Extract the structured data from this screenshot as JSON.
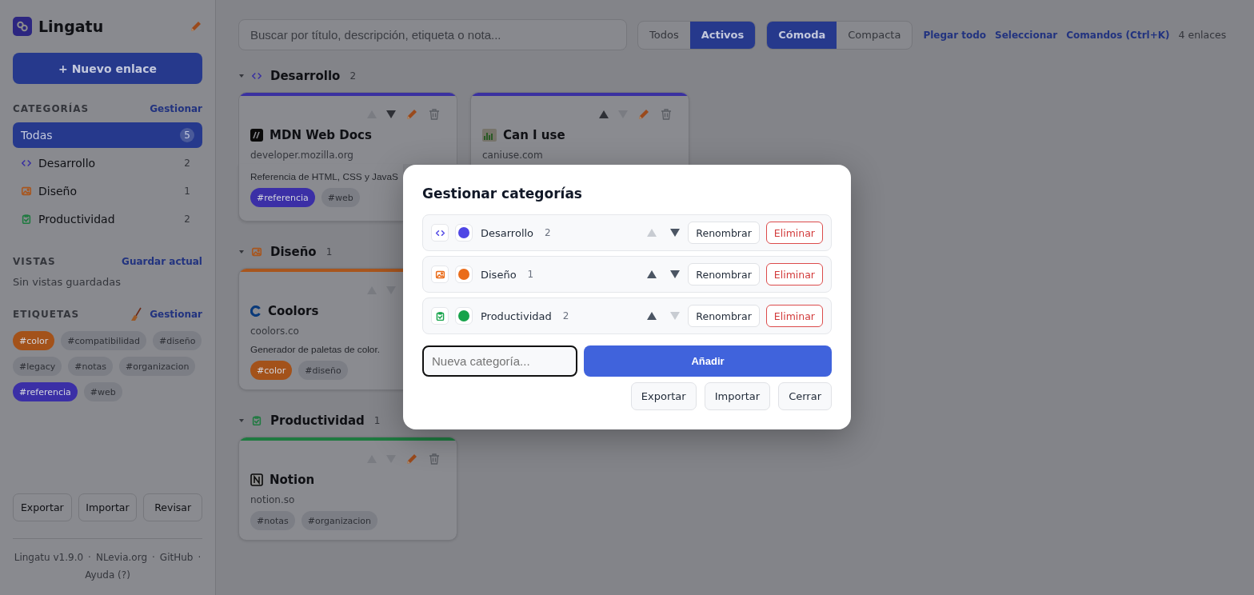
{
  "sidebar": {
    "app_name": "Lingatu",
    "new_button": "+ Nuevo enlace",
    "categories_heading": "CATEGORÍAS",
    "categories_action": "Gestionar",
    "categories": [
      {
        "name": "Todas",
        "count": "5",
        "selected": true
      },
      {
        "name": "Desarrollo",
        "count": "2",
        "selected": false,
        "color": "#3a31a0"
      },
      {
        "name": "Diseño",
        "count": "1",
        "selected": false,
        "color": "#a8561e"
      },
      {
        "name": "Productividad",
        "count": "2",
        "selected": false,
        "color": "#1f7a40"
      }
    ],
    "views_heading": "VISTAS",
    "views_action": "Guardar actual",
    "views_empty": "Sin vistas guardadas",
    "tags_heading": "ETIQUETAS",
    "tags_action": "Gestionar",
    "tags": [
      {
        "label": "#color",
        "color": "#a3521a"
      },
      {
        "label": "#compatibilidad",
        "color": "#7c7e85"
      },
      {
        "label": "#diseño",
        "color": "#7c7e85"
      },
      {
        "label": "#legacy",
        "color": "#7c7e85"
      },
      {
        "label": "#notas",
        "color": "#7c7e85"
      },
      {
        "label": "#organizacion",
        "color": "#7c7e85"
      },
      {
        "label": "#referencia",
        "color": "#3b2fa6"
      },
      {
        "label": "#web",
        "color": "#7c7e85"
      }
    ],
    "buttons": [
      "Exportar",
      "Importar",
      "Revisar"
    ],
    "footer": [
      "Lingatu v1.9.0",
      "·",
      "NLevia.org",
      "·",
      "GitHub",
      "·",
      "Ayuda (?)"
    ]
  },
  "toolbar": {
    "search": {
      "placeholder": "Buscar por título, descripción, etiqueta o nota..."
    },
    "filter": [
      {
        "label": "Todos",
        "selected": false
      },
      {
        "label": "Activos",
        "selected": true
      }
    ],
    "density": [
      {
        "label": "Cómoda",
        "selected": true
      },
      {
        "label": "Compacta",
        "selected": false
      }
    ],
    "links": [
      "Plegar todo",
      "Seleccionar",
      "Comandos (Ctrl+K)"
    ],
    "count": "4 enlaces"
  },
  "sections": [
    {
      "name": "Desarrollo",
      "count": "2",
      "color": "#3a31a0",
      "expanded": true,
      "cards": [
        {
          "title": "MDN Web Docs",
          "domain": "developer.mozilla.org",
          "description": "Referencia de HTML, CSS y JavaS",
          "can_move_up": false,
          "can_move_down": true,
          "actions": true,
          "tags": [
            {
              "label": "#referencia",
              "color": "#3b2fa6"
            },
            {
              "label": "#web",
              "color": "#7c7e85"
            }
          ]
        },
        {
          "title": "Can I use",
          "domain": "caniuse.com",
          "can_move_up": true,
          "can_move_down": false,
          "actions": true
        }
      ]
    },
    {
      "name": "Diseño",
      "count": "1",
      "color": "#a8561e",
      "expanded": true,
      "cards": [
        {
          "title": "Coolors",
          "domain": "coolors.co",
          "description": "Generador de paletas de color.",
          "can_move_up": false,
          "can_move_down": false,
          "actions": false,
          "tags": [
            {
              "label": "#color",
              "color": "#a3521a"
            },
            {
              "label": "#diseño",
              "color": "#7c7e85"
            }
          ]
        }
      ]
    },
    {
      "name": "Productividad",
      "count": "1",
      "color": "#1f7a40",
      "expanded": true,
      "cards": [
        {
          "title": "Notion",
          "domain": "notion.so",
          "can_move_up": false,
          "can_move_down": false,
          "actions": true,
          "tags": [
            {
              "label": "#notas",
              "color": "#7c7e85"
            },
            {
              "label": "#organizacion",
              "color": "#7c7e85"
            }
          ]
        }
      ]
    }
  ],
  "dialog": {
    "title": "Gestionar categorías",
    "rows": [
      {
        "name": "Desarrollo",
        "count": "2",
        "color": "#4f46e5",
        "can_move_up": false,
        "can_move_down": true,
        "rename": "Renombrar",
        "delete": "Eliminar"
      },
      {
        "name": "Diseño",
        "count": "1",
        "color": "#ea6c1a",
        "can_move_up": true,
        "can_move_down": true,
        "rename": "Renombrar",
        "delete": "Eliminar"
      },
      {
        "name": "Productividad",
        "count": "2",
        "color": "#16a34a",
        "can_move_up": true,
        "can_move_down": false,
        "rename": "Renombrar",
        "delete": "Eliminar"
      }
    ],
    "input": {
      "placeholder": "Nueva categoría..."
    },
    "add_button": "Añadir",
    "buttons": [
      "Exportar",
      "Importar",
      "Cerrar"
    ]
  }
}
